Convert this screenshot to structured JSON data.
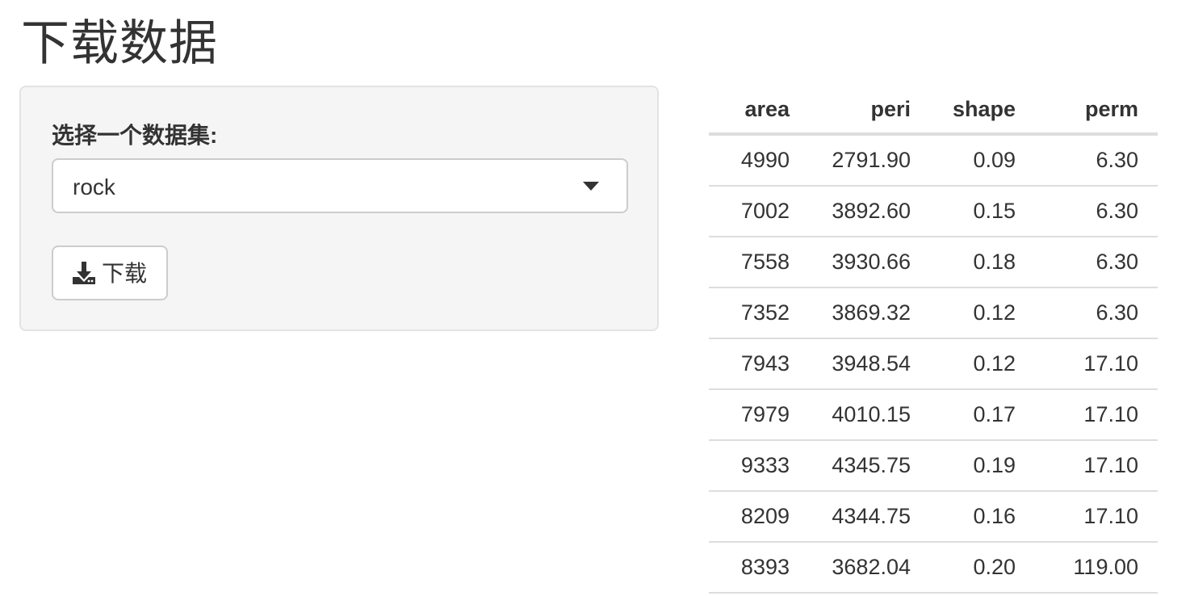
{
  "page": {
    "title": "下载数据"
  },
  "sidebar": {
    "dataset_label": "选择一个数据集:",
    "dataset_selected": "rock",
    "download_label": "下载"
  },
  "table": {
    "columns": [
      "area",
      "peri",
      "shape",
      "perm"
    ],
    "rows": [
      [
        "4990",
        "2791.90",
        "0.09",
        "6.30"
      ],
      [
        "7002",
        "3892.60",
        "0.15",
        "6.30"
      ],
      [
        "7558",
        "3930.66",
        "0.18",
        "6.30"
      ],
      [
        "7352",
        "3869.32",
        "0.12",
        "6.30"
      ],
      [
        "7943",
        "3948.54",
        "0.12",
        "17.10"
      ],
      [
        "7979",
        "4010.15",
        "0.17",
        "17.10"
      ],
      [
        "9333",
        "4345.75",
        "0.19",
        "17.10"
      ],
      [
        "8209",
        "4344.75",
        "0.16",
        "17.10"
      ],
      [
        "8393",
        "3682.04",
        "0.20",
        "119.00"
      ]
    ]
  },
  "icons": {
    "download": "download-icon",
    "dropdown": "chevron-down-icon"
  },
  "colors": {
    "text": "#333333",
    "panel_bg": "#f5f5f5",
    "border": "#cccccc",
    "table_rule": "#dddddd"
  }
}
